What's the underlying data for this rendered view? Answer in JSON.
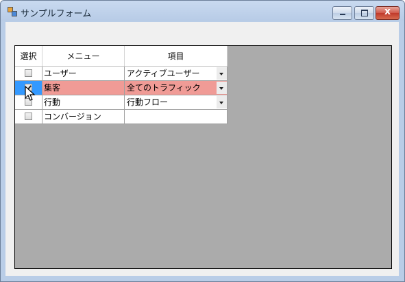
{
  "window": {
    "title": "サンプルフォーム",
    "close_glyph": "x"
  },
  "grid": {
    "columns": [
      "選択",
      "メニュー",
      "項目"
    ],
    "rows": [
      {
        "checked": false,
        "menu": "ユーザー",
        "item": "アクティブユーザー",
        "has_dropdown": true,
        "selected": false
      },
      {
        "checked": true,
        "menu": "集客",
        "item": "全てのトラフィック",
        "has_dropdown": true,
        "selected": true
      },
      {
        "checked": false,
        "menu": "行動",
        "item": "行動フロー",
        "has_dropdown": true,
        "selected": false
      },
      {
        "checked": false,
        "menu": "コンバージョン",
        "item": "",
        "has_dropdown": false,
        "selected": false
      }
    ]
  },
  "colors": {
    "selection_row_header": "#3399ff",
    "selection_cells": "#f09b96",
    "grid_background": "#ababab"
  }
}
